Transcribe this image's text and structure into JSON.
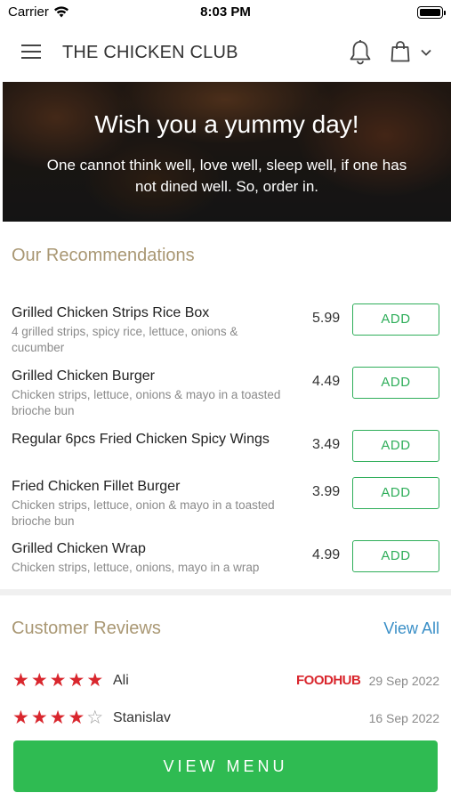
{
  "status_bar": {
    "carrier": "Carrier",
    "time": "8:03 PM"
  },
  "header": {
    "title": "THE CHICKEN CLUB"
  },
  "hero": {
    "title": "Wish you a yummy day!",
    "subtitle_line1": "One cannot think well, love well, sleep well, if one has",
    "subtitle_line2": "not dined well. So, order in."
  },
  "recommendations": {
    "title": "Our Recommendations",
    "add_label": "ADD",
    "items": [
      {
        "name": "Grilled Chicken Strips Rice Box",
        "desc_line1": "4 grilled strips, spicy rice, lettuce, onions &",
        "desc_line2": "cucumber",
        "price": "5.99"
      },
      {
        "name": "Grilled Chicken Burger",
        "desc_line1": "Chicken strips, lettuce, onions & mayo in a toasted",
        "desc_line2": "brioche bun",
        "price": "4.49"
      },
      {
        "name": "Regular 6pcs Fried Chicken Spicy Wings",
        "desc_line1": "",
        "desc_line2": "",
        "price": "3.49"
      },
      {
        "name": "Fried Chicken Fillet Burger",
        "desc_line1": "Chicken strips, lettuce, onion & mayo in a toasted",
        "desc_line2": "brioche bun",
        "price": "3.99"
      },
      {
        "name": "Grilled Chicken Wrap",
        "desc_line1": "Chicken strips, lettuce, onions, mayo in a wrap",
        "desc_line2": "",
        "price": "4.99"
      }
    ]
  },
  "reviews": {
    "title": "Customer Reviews",
    "view_all": "View All",
    "items": [
      {
        "name": "Ali",
        "rating": 5,
        "source": "FOODHUB",
        "date": "29 Sep 2022"
      },
      {
        "name": "Stanislav",
        "rating": 4,
        "source": "",
        "date": "16 Sep 2022"
      }
    ]
  },
  "footer": {
    "view_menu": "VIEW MENU"
  },
  "colors": {
    "accent_green": "#2fbb52",
    "section_title": "#a99773",
    "link_blue": "#3a8fc7",
    "star_red": "#d9262d"
  }
}
